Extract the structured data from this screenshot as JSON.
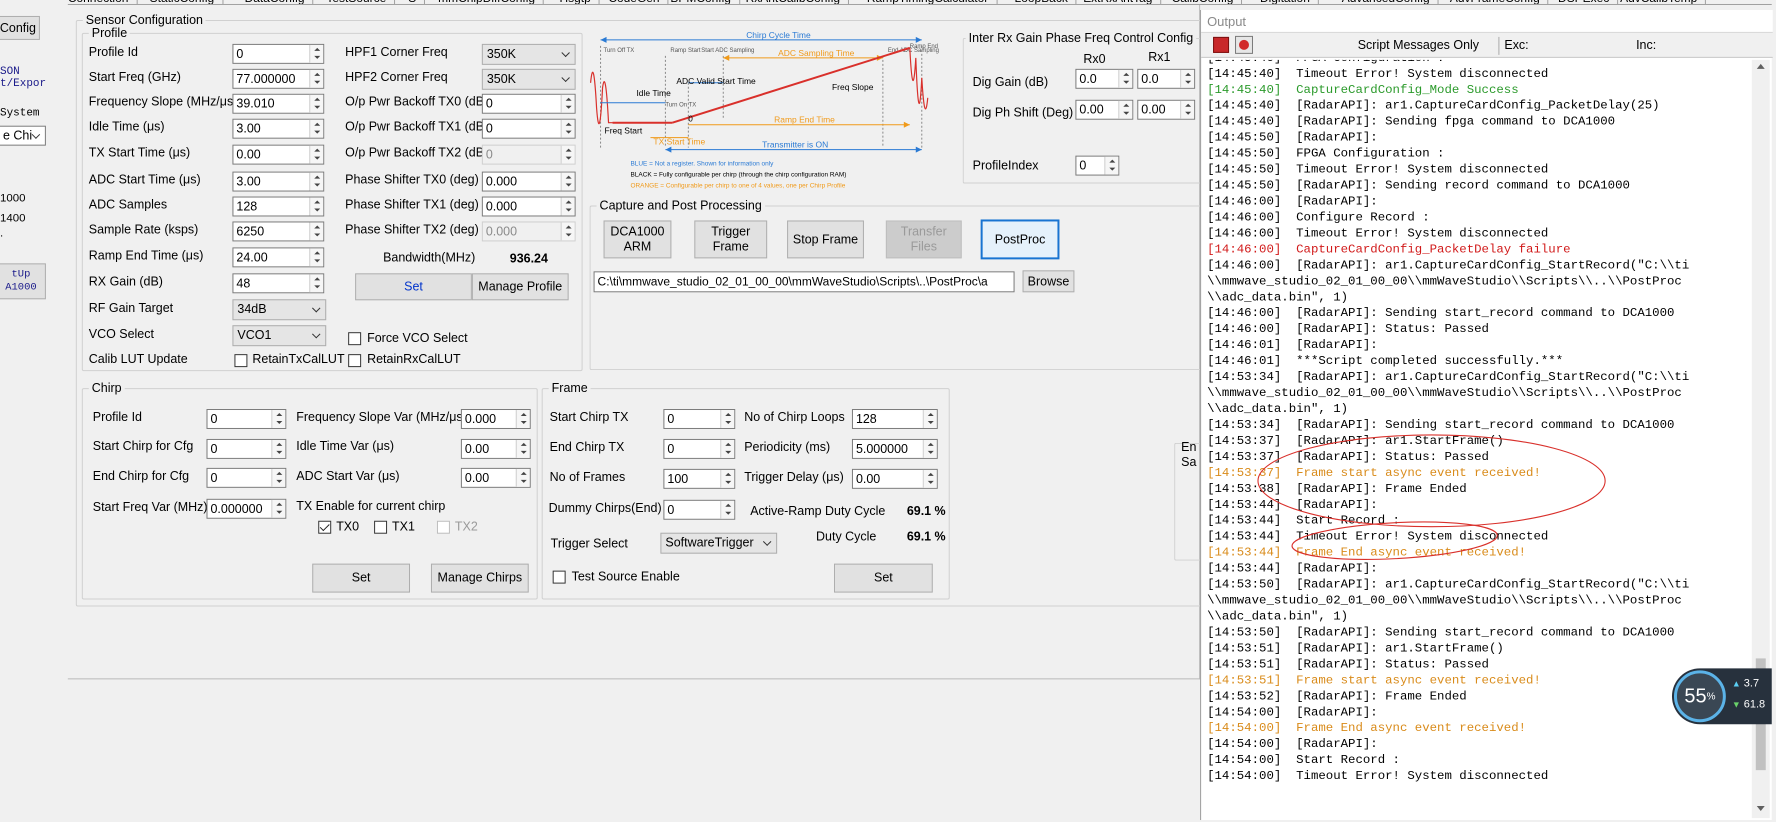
{
  "top_tabs": [
    "Connection",
    "StaticConfig",
    "DataConfig",
    "TestSource",
    "S",
    "mmChipDiffConfig",
    "Hsgtp",
    "CodeGen",
    "BPMConfig",
    "RxAntCalibConfig",
    "RampTimingCalculator",
    "LoopBack",
    "ExtRxAntTag",
    "CalibConfig",
    "Digitation",
    "AdvancedConfig",
    "AdvFrameConfig",
    "DSPExec",
    "AdvCalibTemp"
  ],
  "left_strip": {
    "config_button": "Config",
    "json_label_1": "SON",
    "json_label_2": "t/Expor",
    "system_label": "System",
    "chip_select": "e Chi",
    "val1": "1000",
    "val2": "1400",
    "dot": ".",
    "setup_label_1": "tUp",
    "setup_label_2": "A1000"
  },
  "sensor_config": {
    "title": "Sensor Configuration",
    "profile": {
      "title": "Profile",
      "labels": {
        "profile_id": "Profile Id",
        "start_freq": "Start Freq (GHz)",
        "freq_slope": "Frequency Slope (MHz/μs)",
        "idle_time": "Idle Time (μs)",
        "tx_start_time": "TX Start Time (μs)",
        "adc_start_time": "ADC Start Time (μs)",
        "adc_samples": "ADC Samples",
        "sample_rate": "Sample Rate (ksps)",
        "ramp_end_time": "Ramp End Time (μs)",
        "rx_gain": "RX Gain (dB)",
        "rf_gain_target": "RF Gain Target",
        "vco_select": "VCO Select",
        "calib_lut": "Calib LUT Update",
        "hpf1": "HPF1 Corner Freq",
        "hpf2": "HPF2 Corner Freq",
        "tx0_backoff": "O/p Pwr Backoff TX0 (dB)",
        "tx1_backoff": "O/p Pwr Backoff TX1 (dB)",
        "tx2_backoff": "O/p Pwr Backoff TX2 (dB)",
        "ps_tx0": "Phase Shifter TX0 (deg)",
        "ps_tx1": "Phase Shifter TX1 (deg)",
        "ps_tx2": "Phase Shifter TX2 (deg)",
        "bandwidth": "Bandwidth(MHz)",
        "force_vco": "Force VCO Select",
        "retain_tx": "RetainTxCalLUT",
        "retain_rx": "RetainRxCalLUT"
      },
      "values": {
        "profile_id": "0",
        "start_freq": "77.000000",
        "freq_slope": "39.010",
        "idle_time": "3.00",
        "tx_start_time": "0.00",
        "adc_start_time": "3.00",
        "adc_samples": "128",
        "sample_rate": "6250",
        "ramp_end_time": "24.00",
        "rx_gain": "48",
        "rf_gain_target": "34dB",
        "vco_select": "VCO1",
        "hpf1": "350K",
        "hpf2": "350K",
        "tx0_backoff": "0",
        "tx1_backoff": "0",
        "tx2_backoff": "0",
        "ps_tx0": "0.000",
        "ps_tx1": "0.000",
        "ps_tx2": "0.000",
        "bandwidth": "936.24"
      },
      "buttons": {
        "set": "Set",
        "manage_profile": "Manage Profile"
      }
    },
    "diagram": {
      "chirp_cycle_time": "Chirp Cycle Time",
      "turn_off_tx": "Turn Off TX",
      "ramp_start": "Ramp Start",
      "start_adc_sampling": "Start ADC Sampling",
      "adc_sampling_time": "ADC Sampling Time",
      "end_adc_sampling": "End ADC Sampling",
      "ramp_end": "Ramp End",
      "idle_time": "Idle Time",
      "adc_valid_start_time": "ADC Valid Start Time",
      "freq_slope": "Freq Slope",
      "turn_on_tx": "Turn On TX",
      "freq_start": "Freq Start",
      "zero": "0",
      "ramp_end_time": "Ramp End Time",
      "tx_start_time": "TX Start Time",
      "transmitter_on": "Transmitter is ON",
      "legend_blue": "BLUE = Not a register. Shown for information only",
      "legend_black": "BLACK = Fully configurable per chirp (through the chirp configuration RAM)",
      "legend_orange": "ORANGE = Configurable per chirp to one of 4 values, one per Chirp Profile"
    },
    "inter_rx": {
      "title": "Inter Rx Gain Phase Freq Control Config",
      "rx0": "Rx0",
      "rx1": "Rx1",
      "dig_gain": "Dig Gain (dB)",
      "dig_ph_shift": "Dig Ph Shift (Deg)",
      "dig_gain_rx0": "0.0",
      "dig_gain_rx1": "0.0",
      "dig_ph_rx0": "0.00",
      "dig_ph_rx1": "0.00",
      "profile_index_label": "ProfileIndex",
      "profile_index": "0"
    },
    "capture": {
      "title": "Capture and Post Processing",
      "dca_arm": "DCA1000 ARM",
      "trigger_frame": "Trigger Frame",
      "stop_frame": "Stop Frame",
      "transfer_files": "Transfer Files",
      "postproc": "PostProc",
      "path": "C:\\ti\\mmwave_studio_02_01_00_00\\mmWaveStudio\\Scripts\\..\\PostProc\\a",
      "browse": "Browse"
    },
    "chirp": {
      "title": "Chirp",
      "profile_id": "Profile Id",
      "start_chirp": "Start Chirp for Cfg",
      "end_chirp": "End Chirp for Cfg",
      "start_freq_var": "Start Freq Var (MHz)",
      "freq_slope_var": "Frequency Slope Var (MHz/μs)",
      "idle_time_var": "Idle Time Var (μs)",
      "adc_start_var": "ADC Start Var (μs)",
      "tx_enable": "TX Enable for current chirp",
      "tx0": "TX0",
      "tx1": "TX1",
      "tx2": "TX2",
      "v_profile_id": "0",
      "v_start_chirp": "0",
      "v_end_chirp": "0",
      "v_start_freq_var": "0.000000",
      "v_freq_slope_var": "0.000",
      "v_idle_time_var": "0.00",
      "v_adc_start_var": "0.00",
      "set": "Set",
      "manage_chirps": "Manage Chirps"
    },
    "frame": {
      "title": "Frame",
      "start_chirp_tx": "Start Chirp TX",
      "end_chirp_tx": "End Chirp TX",
      "no_of_frames": "No of Frames",
      "dummy_chirps": "Dummy Chirps(End)",
      "trigger_select": "Trigger Select",
      "no_chirp_loops": "No of Chirp Loops",
      "periodicity": "Periodicity (ms)",
      "trigger_delay": "Trigger Delay (μs)",
      "active_ramp_duty": "Active-Ramp Duty Cycle",
      "duty_cycle": "Duty Cycle",
      "test_source": "Test Source Enable",
      "v_start_chirp_tx": "0",
      "v_end_chirp_tx": "0",
      "v_no_of_frames": "100",
      "v_dummy_chirps": "0",
      "v_trigger_select": "SoftwareTrigger",
      "v_no_chirp_loops": "128",
      "v_periodicity": "5.000000",
      "v_trigger_delay": "0.00",
      "v_active_ramp_duty": "69.1 %",
      "v_duty_cycle": "69.1 %",
      "set": "Set"
    },
    "partial_labels": {
      "en": "En",
      "sa": "Sa"
    }
  },
  "output": {
    "title": "Output",
    "script_messages_only": "Script Messages Only",
    "exc": "Exc:",
    "inc": "Inc:",
    "lines": [
      {
        "t": "[14:45:40]  FPGA Configuration :",
        "c": "black"
      },
      {
        "t": "[14:45:40]  Timeout Error! System disconnected",
        "c": "black"
      },
      {
        "t": "[14:45:40]  CaptureCardConfig_Mode Success",
        "c": "green"
      },
      {
        "t": "[14:45:40]  [RadarAPI]: ar1.CaptureCardConfig_PacketDelay(25)",
        "c": "black"
      },
      {
        "t": "[14:45:40]  [RadarAPI]: Sending fpga command to DCA1000",
        "c": "black"
      },
      {
        "t": "[14:45:50]  [RadarAPI]:",
        "c": "black"
      },
      {
        "t": "[14:45:50]  FPGA Configuration :",
        "c": "black"
      },
      {
        "t": "[14:45:50]  Timeout Error! System disconnected",
        "c": "black"
      },
      {
        "t": "[14:45:50]  [RadarAPI]: Sending record command to DCA1000",
        "c": "black"
      },
      {
        "t": "[14:46:00]  [RadarAPI]:",
        "c": "black"
      },
      {
        "t": "[14:46:00]  Configure Record :",
        "c": "black"
      },
      {
        "t": "[14:46:00]  Timeout Error! System disconnected",
        "c": "black"
      },
      {
        "t": "[14:46:00]  CaptureCardConfig_PacketDelay failure",
        "c": "red"
      },
      {
        "t": "[14:46:00]  [RadarAPI]: ar1.CaptureCardConfig_StartRecord(\"C:\\\\ti",
        "c": "black"
      },
      {
        "t": "\\\\mmwave_studio_02_01_00_00\\\\mmWaveStudio\\\\Scripts\\\\..\\\\PostProc",
        "c": "black"
      },
      {
        "t": "\\\\adc_data.bin\", 1)",
        "c": "black"
      },
      {
        "t": "[14:46:00]  [RadarAPI]: Sending start_record command to DCA1000",
        "c": "black"
      },
      {
        "t": "[14:46:00]  [RadarAPI]: Status: Passed",
        "c": "black"
      },
      {
        "t": "[14:46:01]  [RadarAPI]:",
        "c": "black"
      },
      {
        "t": "[14:46:01]  ***Script completed successfully.***",
        "c": "black"
      },
      {
        "t": "[14:53:34]  [RadarAPI]: ar1.CaptureCardConfig_StartRecord(\"C:\\\\ti",
        "c": "black"
      },
      {
        "t": "\\\\mmwave_studio_02_01_00_00\\\\mmWaveStudio\\\\Scripts\\\\..\\\\PostProc",
        "c": "black"
      },
      {
        "t": "\\\\adc_data.bin\", 1)",
        "c": "black"
      },
      {
        "t": "[14:53:34]  [RadarAPI]: Sending start_record command to DCA1000",
        "c": "black"
      },
      {
        "t": "[14:53:37]  [RadarAPI]: ar1.StartFrame()",
        "c": "black"
      },
      {
        "t": "[14:53:37]  [RadarAPI]: Status: Passed",
        "c": "black"
      },
      {
        "t": "[14:53:37]  Frame start async event received!",
        "c": "orange"
      },
      {
        "t": "[14:53:38]  [RadarAPI]: Frame Ended",
        "c": "black"
      },
      {
        "t": "[14:53:44]  [RadarAPI]:",
        "c": "black"
      },
      {
        "t": "[14:53:44]  Start Record :",
        "c": "black"
      },
      {
        "t": "[14:53:44]  Timeout Error! System disconnected",
        "c": "black"
      },
      {
        "t": "[14:53:44]  Frame End async event received!",
        "c": "orange"
      },
      {
        "t": "[14:53:44]  [RadarAPI]:",
        "c": "black"
      },
      {
        "t": "[14:53:50]  [RadarAPI]: ar1.CaptureCardConfig_StartRecord(\"C:\\\\ti",
        "c": "black"
      },
      {
        "t": "\\\\mmwave_studio_02_01_00_00\\\\mmWaveStudio\\\\Scripts\\\\..\\\\PostProc",
        "c": "black"
      },
      {
        "t": "\\\\adc_data.bin\", 1)",
        "c": "black"
      },
      {
        "t": "[14:53:50]  [RadarAPI]: Sending start_record command to DCA1000",
        "c": "black"
      },
      {
        "t": "[14:53:51]  [RadarAPI]: ar1.StartFrame()",
        "c": "black"
      },
      {
        "t": "[14:53:51]  [RadarAPI]: Status: Passed",
        "c": "black"
      },
      {
        "t": "[14:53:51]  Frame start async event received!",
        "c": "orange"
      },
      {
        "t": "[14:53:52]  [RadarAPI]: Frame Ended",
        "c": "black"
      },
      {
        "t": "[14:54:00]  [RadarAPI]:",
        "c": "black"
      },
      {
        "t": "[14:54:00]  Frame End async event received!",
        "c": "orange"
      },
      {
        "t": "[14:54:00]  [RadarAPI]:",
        "c": "black"
      },
      {
        "t": "[14:54:00]  Start Record :",
        "c": "black"
      },
      {
        "t": "[14:54:00]  Timeout Error! System disconnected",
        "c": "black"
      }
    ]
  },
  "widget": {
    "percent": "55",
    "unit": "%",
    "up": "3.7",
    "down": "61.8"
  },
  "colors": {
    "accent_blue": "#1874d2",
    "log_green": "#2b9a2b",
    "log_red": "#d11a1a",
    "log_orange": "#d98b1a",
    "annotation_red": "#d9302b"
  }
}
